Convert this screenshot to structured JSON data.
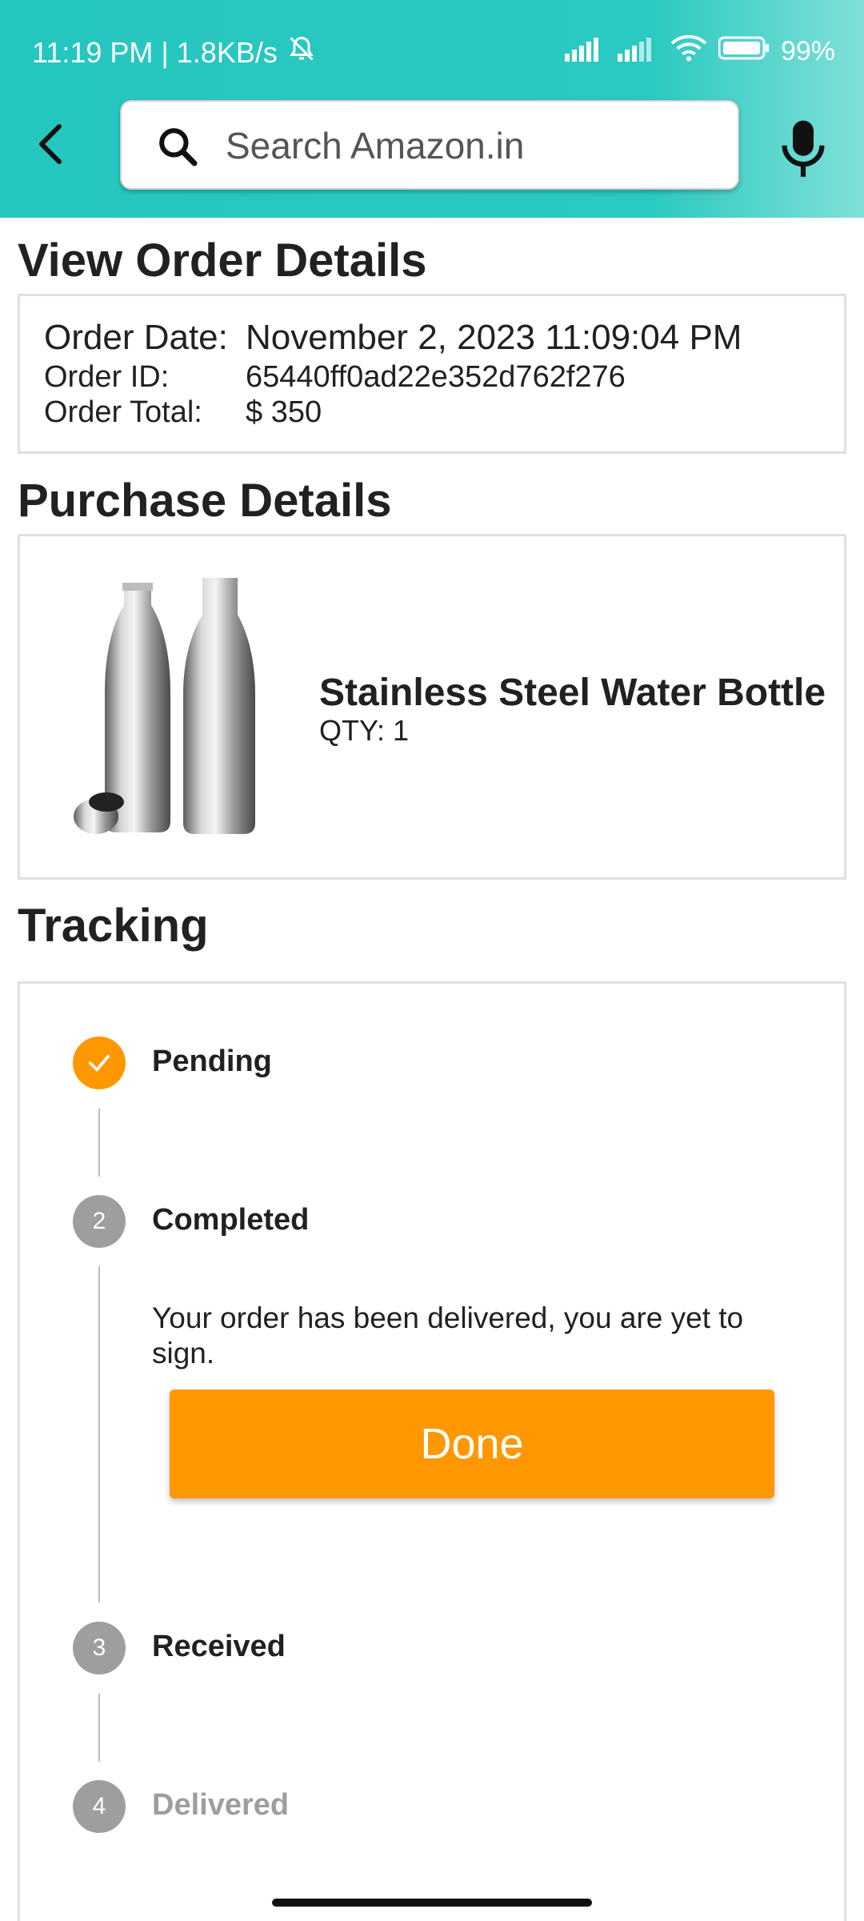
{
  "status_bar": {
    "time_speed": "11:19 PM | 1.8KB/s",
    "battery": "99%"
  },
  "search": {
    "placeholder": "Search Amazon.in"
  },
  "order_details": {
    "title": "View Order Details",
    "date_label": "Order Date:",
    "date_value": "November 2, 2023 11:09:04 PM",
    "id_label": "Order ID:",
    "id_value": "65440ff0ad22e352d762f276",
    "total_label": "Order Total:",
    "total_value": "$ 350"
  },
  "purchase": {
    "title": "Purchase Details",
    "product_name": "Stainless Steel Water Bottle",
    "qty": "QTY: 1"
  },
  "tracking": {
    "title": "Tracking",
    "steps": [
      {
        "number": "✓",
        "label": "Pending",
        "state": "done"
      },
      {
        "number": "2",
        "label": "Completed",
        "state": "active"
      },
      {
        "number": "3",
        "label": "Received",
        "state": "pending"
      },
      {
        "number": "4",
        "label": "Delivered",
        "state": "disabled"
      }
    ],
    "completed_message": "Your order has been delivered, you are yet to sign.",
    "done_button": "Done"
  },
  "colors": {
    "header_teal": "#26c6c0",
    "accent_orange": "#ff9800",
    "step_grey": "#9e9e9e"
  }
}
